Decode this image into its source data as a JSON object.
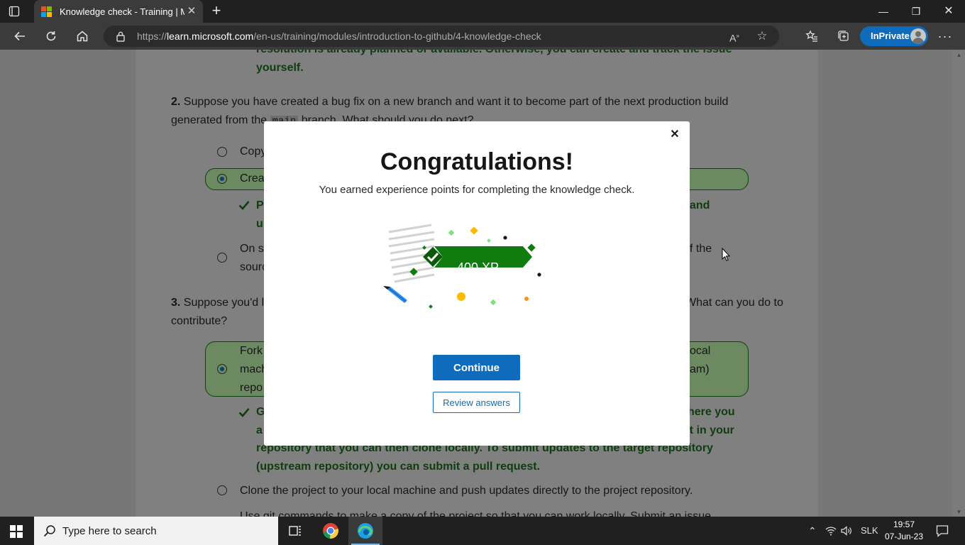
{
  "browser": {
    "tab_title": "Knowledge check - Training | Mic",
    "url_domain": "learn.microsoft.com",
    "url_prefix": "https://",
    "url_path": "/en-us/training/modules/introduction-to-github/4-knowledge-check",
    "inprivate_label": "InPrivate"
  },
  "background": {
    "q1_tail_line1": "resolution is already planned or available. Otherwise, you can create and track the issue",
    "q1_tail_line2": "yourself.",
    "q2_number": "2.",
    "q2_line1": "Suppose you have created a bug fix on a new branch and want it to become part of the next production build",
    "q2_line2a": "generated from the",
    "q2_code": "main",
    "q2_line2b": "branch. What should you do next?",
    "q2_opt1": "Copy",
    "q2_opt2": "Creat",
    "q2_fb_a": "P",
    "q2_fb_b": "u",
    "q2_fb_right": "and",
    "q2_opt3a": "On so",
    "q2_opt3b": "sourc",
    "q2_opt3_right": "f the",
    "q3_number": "3.",
    "q3_line1a": "Suppose you'd l",
    "q3_line1b": "What can you do to",
    "q3_line2": "contribute?",
    "q3_opt1a": "Fork",
    "q3_opt1b": "mach",
    "q3_opt1c": "repo",
    "q3_opt1_r1": "ocal",
    "q3_opt1_r2": "am)",
    "q3_fb_a": "G",
    "q3_fb_b": "a",
    "q3_fb_r1": "here you",
    "q3_fb_r2": "ect in your",
    "q3_fb_line3": "repository that you can then clone locally. To submit updates to the target repository",
    "q3_fb_line4": "(upstream repository) you can submit a pull request.",
    "q3_opt2": "Clone the project to your local machine and push updates directly to the project repository.",
    "q3_opt3_partial": "Use git commands to make a copy of the project so that you can work locally. Submit an issue"
  },
  "modal": {
    "title": "Congratulations!",
    "subtitle": "You earned experience points for completing the knowledge check.",
    "xp_badge": "400 XP",
    "continue_label": "Continue",
    "review_label": "Review answers"
  },
  "taskbar": {
    "search_placeholder": "Type here to search",
    "language": "SLK",
    "time": "19:57",
    "date": "07-Jun-23"
  },
  "colors": {
    "accent": "#0f6cbd",
    "badge_green": "#107c10",
    "feedback_green": "#107c10"
  }
}
